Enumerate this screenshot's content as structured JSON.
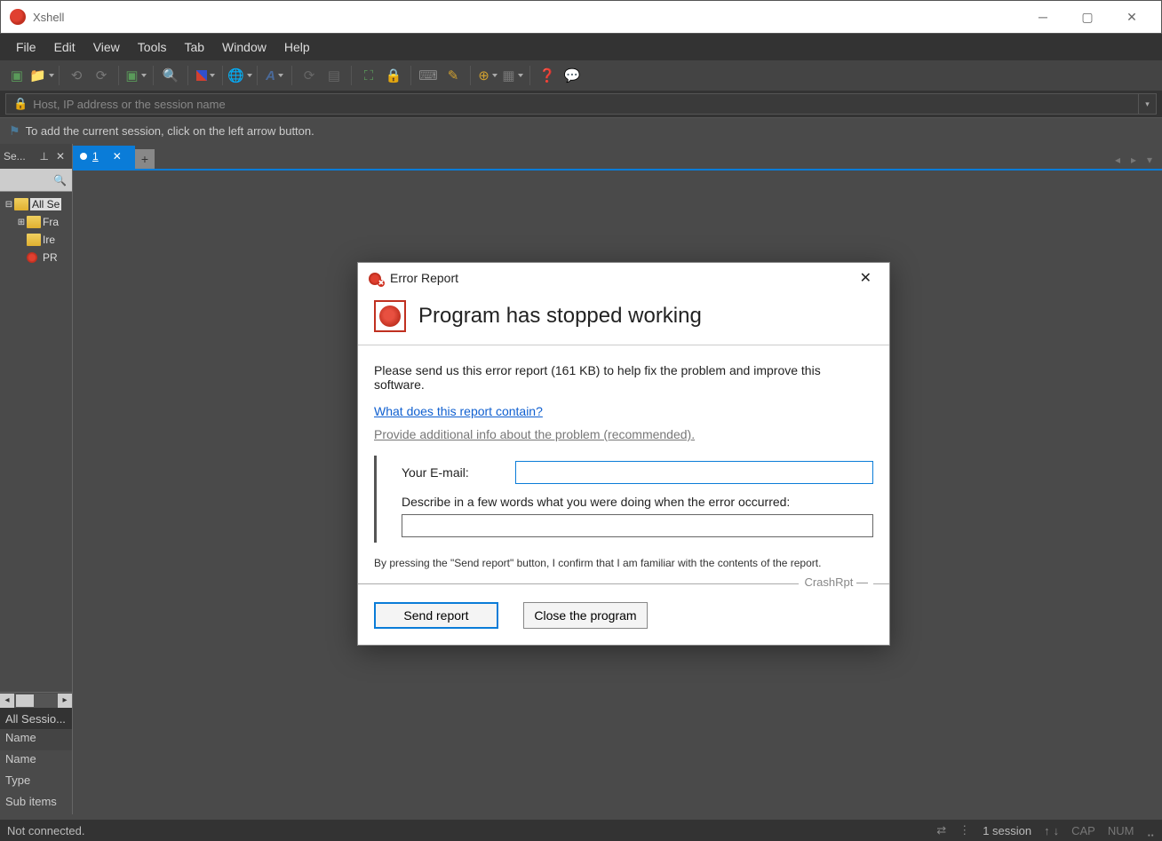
{
  "window": {
    "title": "Xshell"
  },
  "menu": [
    "File",
    "Edit",
    "View",
    "Tools",
    "Tab",
    "Window",
    "Help"
  ],
  "addressbar": {
    "placeholder": "Host, IP address or the session name"
  },
  "infobar": {
    "text": "To add the current session, click on the left arrow button."
  },
  "sidebar": {
    "title": "Se...",
    "tree": {
      "root": "All Se",
      "items": [
        "Fra",
        "Ire",
        "PR"
      ]
    },
    "props_header": "All Sessio...",
    "props": [
      "Name",
      "Name",
      "Type",
      "Sub items"
    ]
  },
  "tabs": {
    "active": "1"
  },
  "statusbar": {
    "left": "Not connected.",
    "session": "1 session",
    "cap": "CAP",
    "num": "NUM"
  },
  "modal": {
    "title": "Error Report",
    "heading": "Program has stopped working",
    "message": "Please send us this error report (161 KB) to help fix the problem and improve this software.",
    "link1": "What does this report contain?",
    "link2": "Provide additional info about the problem (recommended).",
    "email_label": "Your E-mail:",
    "describe_label": "Describe in a few words what you were doing when the error occurred:",
    "confirm": "By pressing the \"Send report\" button, I confirm that I am familiar with the contents of the report.",
    "brand": "CrashRpt",
    "send_btn": "Send report",
    "close_btn": "Close the program"
  }
}
